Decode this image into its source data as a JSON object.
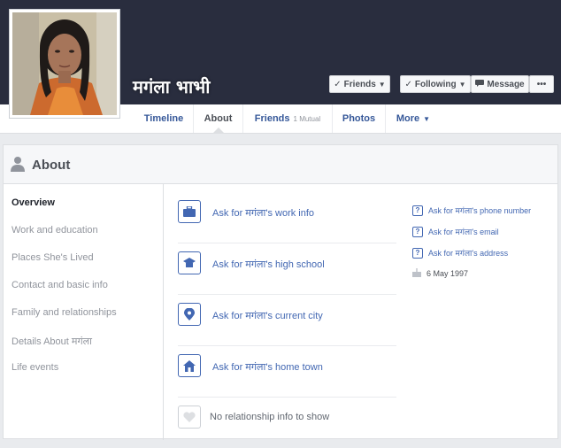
{
  "profile": {
    "name": "मगंला भाभी"
  },
  "header_buttons": {
    "friends": "Friends",
    "following": "Following",
    "message": "Message",
    "more_dots": "•••"
  },
  "tabs": [
    {
      "label": "Timeline"
    },
    {
      "label": "About"
    },
    {
      "label": "Friends",
      "sub": "1 Mutual"
    },
    {
      "label": "Photos"
    },
    {
      "label": "More"
    }
  ],
  "about": {
    "title": "About",
    "nav": [
      "Overview",
      "Work and education",
      "Places She's Lived",
      "Contact and basic info",
      "Family and relationships",
      "Details About मगंला",
      "Life events"
    ],
    "rows": [
      {
        "label": "Ask for मगंला's work info",
        "icon": "briefcase-icon"
      },
      {
        "label": "Ask for मगंला's high school",
        "icon": "graduation-cap-icon"
      },
      {
        "label": "Ask for मगंला's current city",
        "icon": "location-pin-icon"
      },
      {
        "label": "Ask for मगंला's home town",
        "icon": "house-icon"
      },
      {
        "label": "No relationship info to show",
        "icon": "heart-icon"
      }
    ],
    "side": [
      {
        "label": "Ask for मगंला's phone number"
      },
      {
        "label": "Ask for मगंला's email"
      },
      {
        "label": "Ask for मगंला's address"
      },
      {
        "label": "6 May 1997"
      }
    ]
  },
  "colors": {
    "cover": "#292d3e",
    "link": "#4267b2"
  }
}
